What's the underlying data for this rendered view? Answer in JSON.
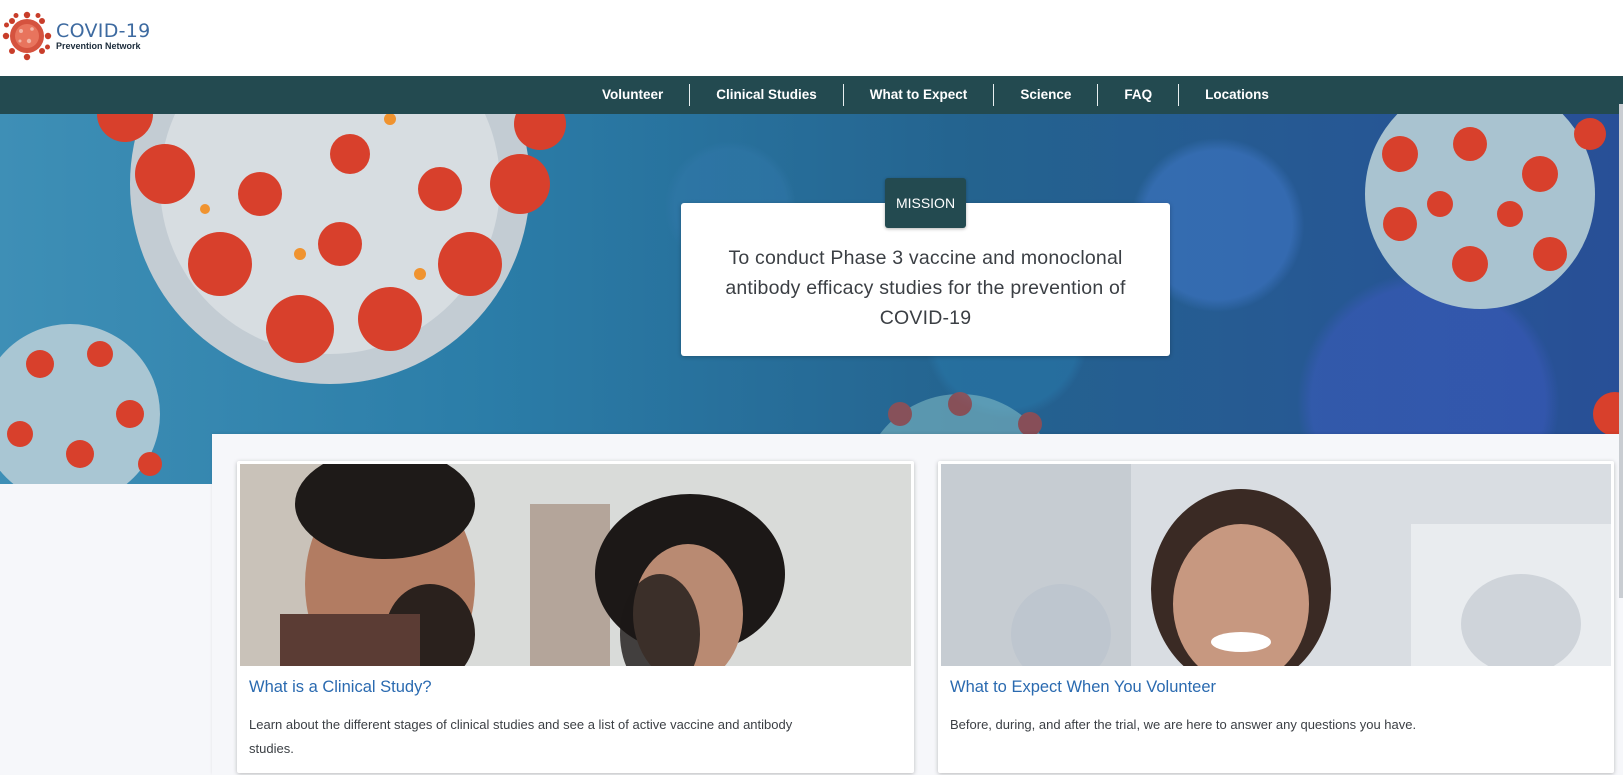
{
  "logo": {
    "title": "COVID-19",
    "subtitle": "Prevention Network"
  },
  "nav": {
    "items": [
      {
        "label": "Volunteer"
      },
      {
        "label": "Clinical Studies"
      },
      {
        "label": "What to Expect"
      },
      {
        "label": "Science"
      },
      {
        "label": "FAQ"
      },
      {
        "label": "Locations"
      }
    ]
  },
  "hero": {
    "badge": "MISSION",
    "text": "To conduct Phase 3 vaccine and monoclonal antibody efficacy studies for the prevention of COVID-19"
  },
  "cards": [
    {
      "title": "What is a Clinical Study?",
      "description": "Learn about the different stages of clinical studies and see a list of active vaccine and antibody studies."
    },
    {
      "title": "What to Expect When You Volunteer",
      "description": "Before, during, and after the trial, we are here to answer any questions you have."
    }
  ],
  "colors": {
    "nav_bg": "#234a50",
    "link": "#2a6ab0",
    "logo_blue": "#3d6aa0",
    "virus_red": "#d8402c"
  },
  "icons": {
    "logo": "coronavirus-icon"
  }
}
